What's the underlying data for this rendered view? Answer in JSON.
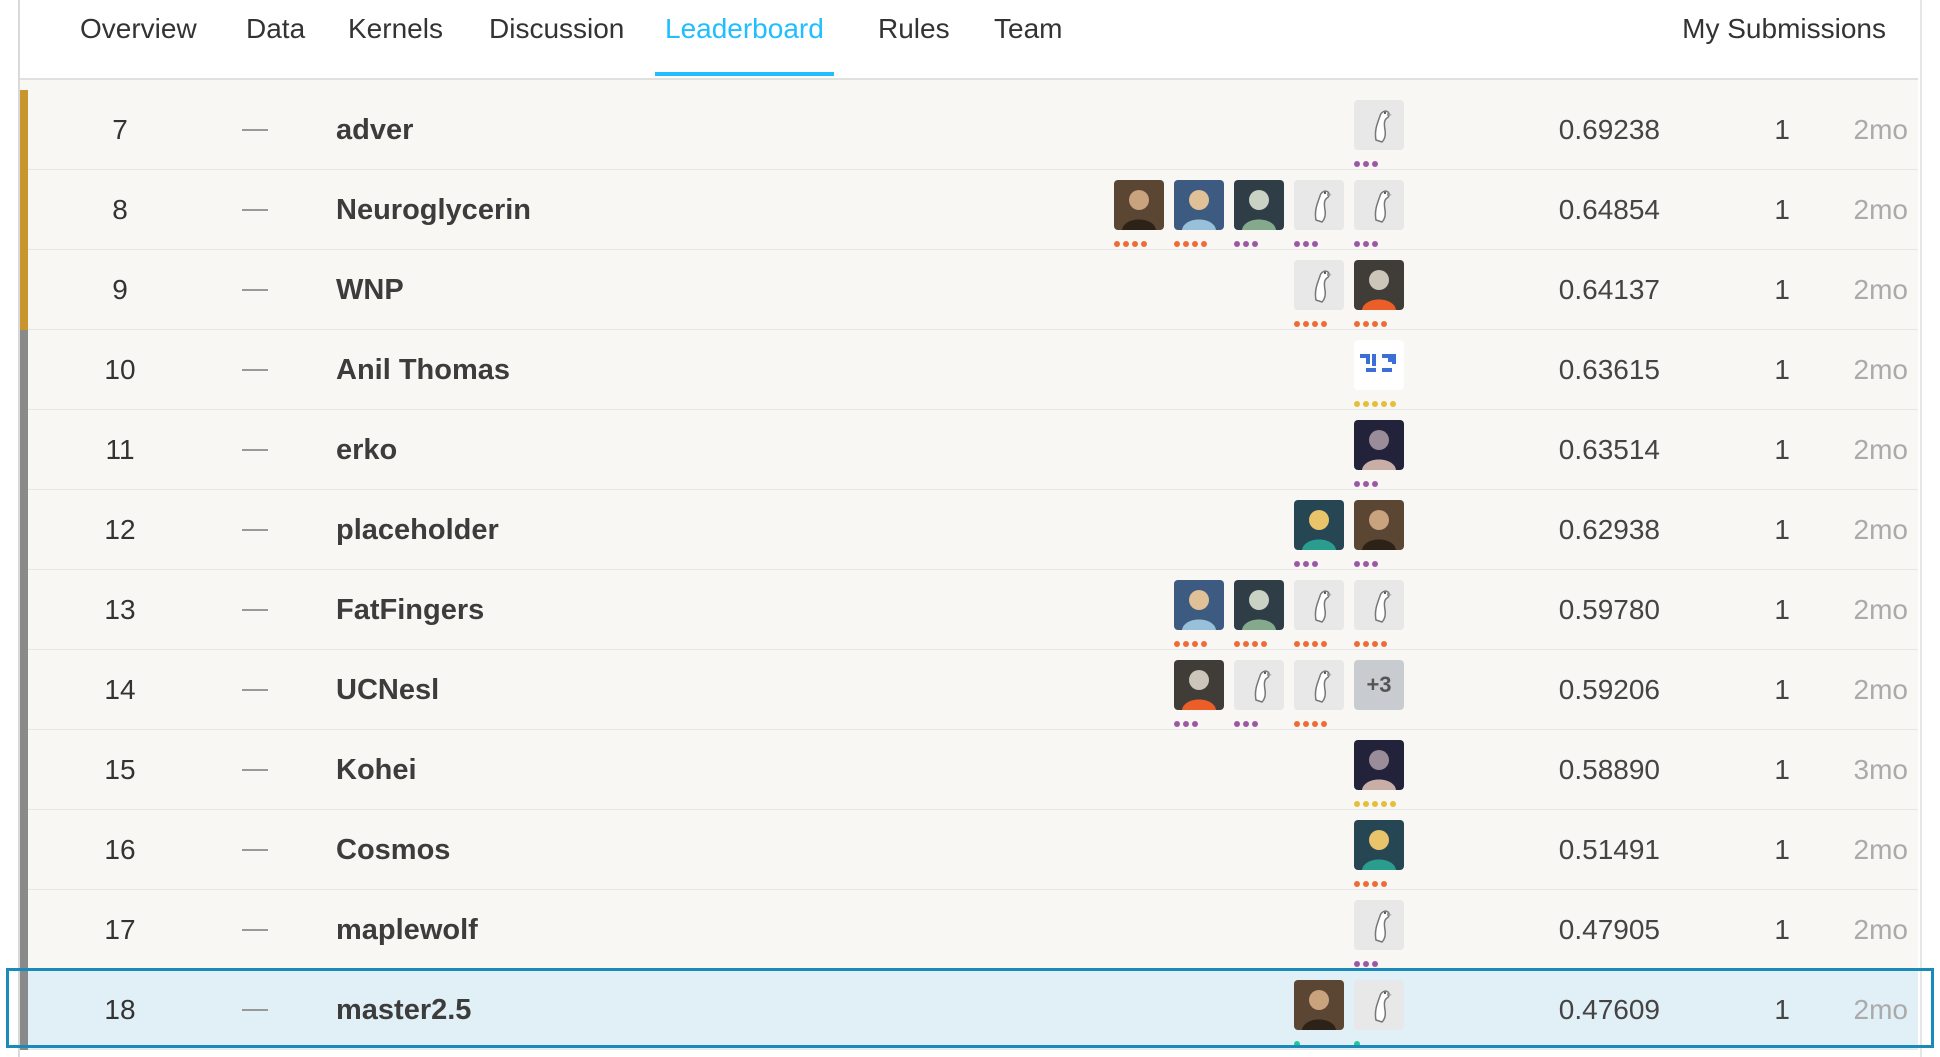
{
  "nav": {
    "tabs": [
      {
        "label": "Overview"
      },
      {
        "label": "Data"
      },
      {
        "label": "Kernels"
      },
      {
        "label": "Discussion"
      },
      {
        "label": "Leaderboard"
      },
      {
        "label": "Rules"
      },
      {
        "label": "Team"
      }
    ],
    "active": "Leaderboard",
    "my_submissions": "My Submissions"
  },
  "colors": {
    "active_tab": "#20beff",
    "medal_gold": "#c8962c",
    "medal_none": "#8a8a8a",
    "tier_orange": "#f06b36",
    "tier_purple": "#9b59a4",
    "tier_gold": "#e5be3a",
    "tier_green": "#20c997",
    "highlight_border": "#1a8ab8"
  },
  "rows": [
    {
      "rank": "7",
      "change": "—",
      "team": "adver",
      "score": "0.69238",
      "entries": "1",
      "last": "2mo",
      "medal": "gold",
      "members": [
        {
          "icon": "goose-avatar-icon",
          "tier": "purple",
          "dots": 3
        }
      ]
    },
    {
      "rank": "8",
      "change": "—",
      "team": "Neuroglycerin",
      "score": "0.64854",
      "entries": "1",
      "last": "2mo",
      "medal": "gold",
      "members": [
        {
          "icon": "user-photo-avatar-icon",
          "tier": "orange",
          "dots": 4
        },
        {
          "icon": "user-photo-avatar-icon",
          "tier": "orange",
          "dots": 4
        },
        {
          "icon": "user-photo-avatar-icon",
          "tier": "purple",
          "dots": 3
        },
        {
          "icon": "goose-avatar-icon",
          "tier": "purple",
          "dots": 3
        },
        {
          "icon": "goose-avatar-icon",
          "tier": "purple",
          "dots": 3
        }
      ]
    },
    {
      "rank": "9",
      "change": "—",
      "team": "WNP",
      "score": "0.64137",
      "entries": "1",
      "last": "2mo",
      "medal": "gold",
      "members": [
        {
          "icon": "goose-avatar-icon",
          "tier": "orange",
          "dots": 4
        },
        {
          "icon": "user-photo-avatar-icon",
          "tier": "orange",
          "dots": 4
        }
      ]
    },
    {
      "rank": "10",
      "change": "—",
      "team": "Anil Thomas",
      "score": "0.63615",
      "entries": "1",
      "last": "2mo",
      "medal": "none",
      "members": [
        {
          "icon": "pattern-avatar-icon",
          "tier": "gold",
          "dots": 5
        }
      ]
    },
    {
      "rank": "11",
      "change": "—",
      "team": "erko",
      "score": "0.63514",
      "entries": "1",
      "last": "2mo",
      "medal": "none",
      "members": [
        {
          "icon": "user-photo-avatar-icon",
          "tier": "purple",
          "dots": 3
        }
      ]
    },
    {
      "rank": "12",
      "change": "—",
      "team": "placeholder",
      "score": "0.62938",
      "entries": "1",
      "last": "2mo",
      "medal": "none",
      "members": [
        {
          "icon": "user-photo-avatar-icon",
          "tier": "purple",
          "dots": 3
        },
        {
          "icon": "user-photo-avatar-icon",
          "tier": "purple",
          "dots": 3
        }
      ]
    },
    {
      "rank": "13",
      "change": "—",
      "team": "FatFingers",
      "score": "0.59780",
      "entries": "1",
      "last": "2mo",
      "medal": "none",
      "members": [
        {
          "icon": "user-photo-avatar-icon",
          "tier": "orange",
          "dots": 4
        },
        {
          "icon": "user-photo-avatar-icon",
          "tier": "orange",
          "dots": 4
        },
        {
          "icon": "goose-avatar-icon",
          "tier": "orange",
          "dots": 4
        },
        {
          "icon": "goose-avatar-icon",
          "tier": "orange",
          "dots": 4
        }
      ]
    },
    {
      "rank": "14",
      "change": "—",
      "team": "UCNesl",
      "score": "0.59206",
      "entries": "1",
      "last": "2mo",
      "medal": "none",
      "members": [
        {
          "icon": "user-photo-avatar-icon",
          "tier": "purple",
          "dots": 3
        },
        {
          "icon": "goose-avatar-icon",
          "tier": "purple",
          "dots": 3
        },
        {
          "icon": "goose-avatar-icon",
          "tier": "orange",
          "dots": 4
        },
        {
          "icon": "more-members-icon",
          "label": "+3",
          "tier": "none",
          "dots": 0
        }
      ]
    },
    {
      "rank": "15",
      "change": "—",
      "team": "Kohei",
      "score": "0.58890",
      "entries": "1",
      "last": "3mo",
      "medal": "none",
      "members": [
        {
          "icon": "user-photo-avatar-icon",
          "tier": "gold",
          "dots": 5
        }
      ]
    },
    {
      "rank": "16",
      "change": "—",
      "team": "Cosmos",
      "score": "0.51491",
      "entries": "1",
      "last": "2mo",
      "medal": "none",
      "members": [
        {
          "icon": "user-photo-avatar-icon",
          "tier": "orange",
          "dots": 4
        }
      ]
    },
    {
      "rank": "17",
      "change": "—",
      "team": "maplewolf",
      "score": "0.47905",
      "entries": "1",
      "last": "2mo",
      "medal": "none",
      "members": [
        {
          "icon": "goose-avatar-icon",
          "tier": "purple",
          "dots": 3
        }
      ]
    },
    {
      "rank": "18",
      "change": "—",
      "team": "master2.5",
      "score": "0.47609",
      "entries": "1",
      "last": "2mo",
      "medal": "none",
      "me": true,
      "members": [
        {
          "icon": "user-photo-avatar-icon",
          "tier": "green",
          "dots": 1
        },
        {
          "icon": "goose-avatar-icon",
          "tier": "green",
          "dots": 1
        }
      ]
    }
  ]
}
